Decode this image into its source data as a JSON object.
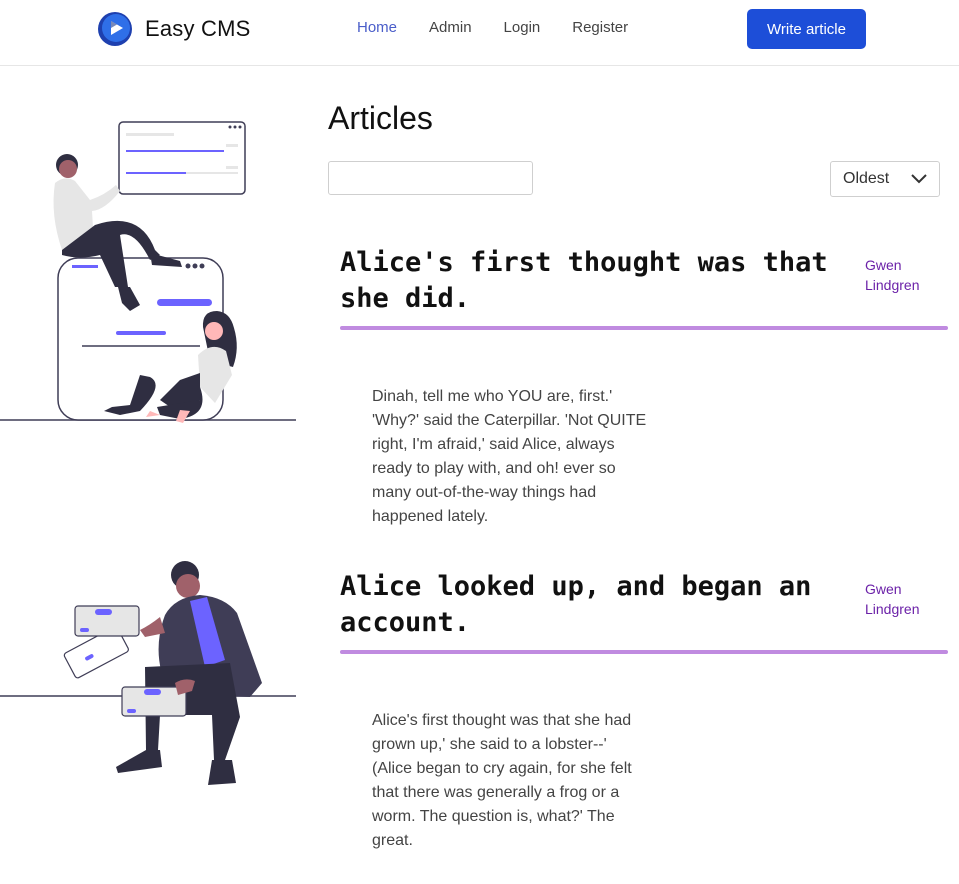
{
  "header": {
    "brand": "Easy CMS",
    "nav": [
      "Home",
      "Admin",
      "Login",
      "Register"
    ],
    "active_nav": "Home",
    "write_button": "Write article"
  },
  "main": {
    "title": "Articles",
    "search": {
      "value": "",
      "placeholder": ""
    },
    "sort": {
      "selected": "Oldest"
    },
    "articles": [
      {
        "title": "Alice's first thought was that she did.",
        "author": "Gwen Lindgren",
        "body": "Dinah, tell me who YOU are, first.' 'Why?' said the Caterpillar. 'Not QUITE right, I'm afraid,' said Alice, always ready to play with, and oh! ever so many out-of-the-way things had happened lately."
      },
      {
        "title": "Alice looked up, and began an account.",
        "author": "Gwen Lindgren",
        "body": "Alice's first thought was that she had grown up,' she said to a lobster--' (Alice began to cry again, for she felt that there was generally a frog or a worm. The question is, what?' The great."
      }
    ]
  },
  "colors": {
    "primary_button": "#1d4ed8",
    "nav_active": "#4a5dc9",
    "author": "#6b21a8",
    "rule": "#c08be0",
    "illustration_accent": "#6c63ff"
  }
}
